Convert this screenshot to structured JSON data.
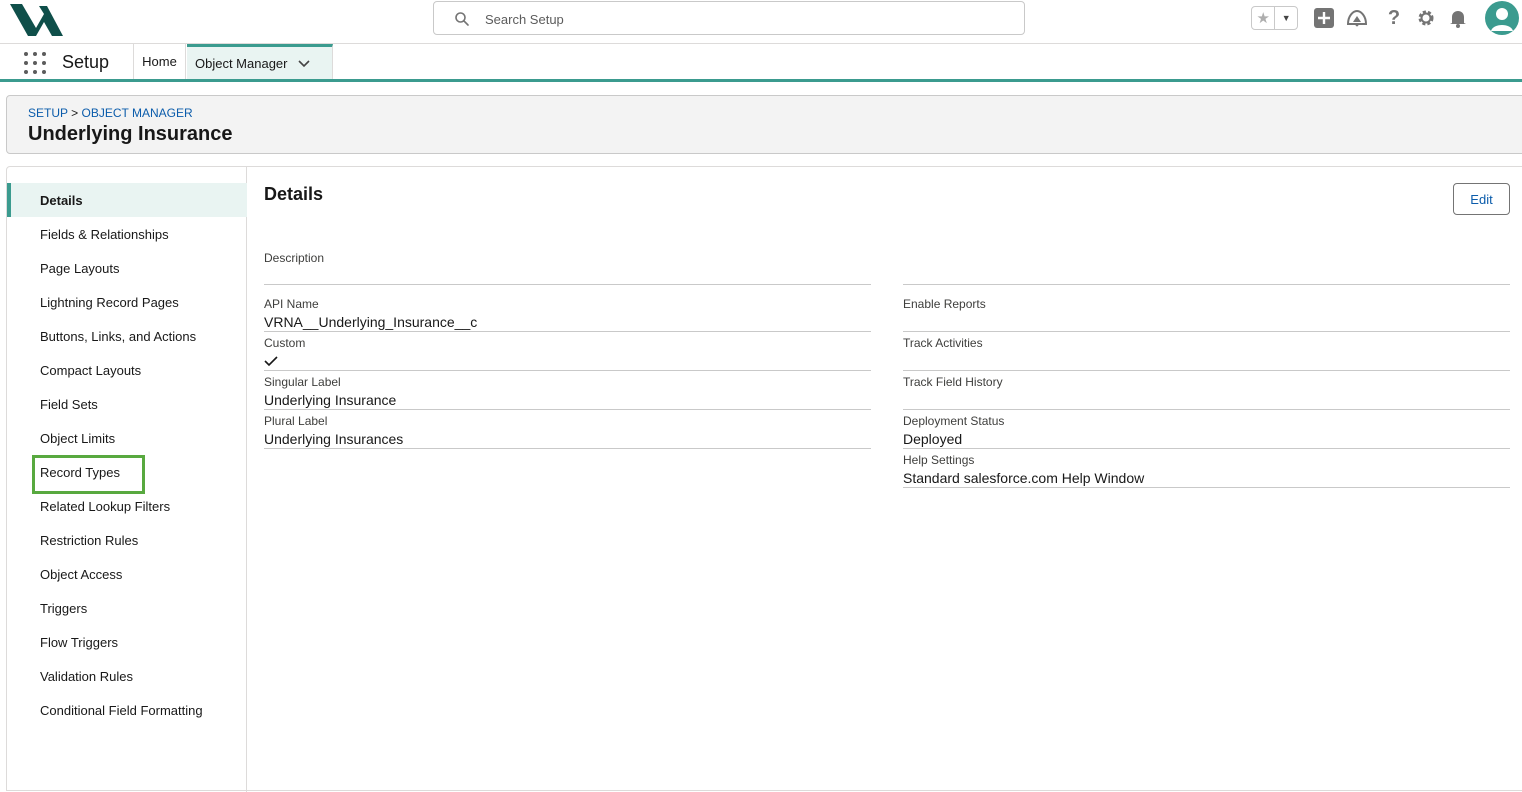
{
  "header": {
    "search_placeholder": "Search Setup",
    "icons": [
      "search-icon",
      "favorite-star-icon",
      "favorites-dropdown-icon",
      "global-actions-add-icon",
      "trailhead-icon",
      "help-icon",
      "setup-gear-icon",
      "notifications-bell-icon",
      "user-avatar-icon"
    ]
  },
  "nav": {
    "app_name": "Setup",
    "tabs": [
      {
        "label": "Home"
      },
      {
        "label": "Object Manager"
      }
    ]
  },
  "page": {
    "breadcrumb": {
      "setup": "SETUP",
      "sep": ">",
      "object_manager": "OBJECT MANAGER"
    },
    "title": "Underlying Insurance"
  },
  "sidebar": {
    "items": [
      {
        "label": "Details"
      },
      {
        "label": "Fields & Relationships"
      },
      {
        "label": "Page Layouts"
      },
      {
        "label": "Lightning Record Pages"
      },
      {
        "label": "Buttons, Links, and Actions"
      },
      {
        "label": "Compact Layouts"
      },
      {
        "label": "Field Sets"
      },
      {
        "label": "Object Limits"
      },
      {
        "label": "Record Types"
      },
      {
        "label": "Related Lookup Filters"
      },
      {
        "label": "Restriction Rules"
      },
      {
        "label": "Object Access"
      },
      {
        "label": "Triggers"
      },
      {
        "label": "Flow Triggers"
      },
      {
        "label": "Validation Rules"
      },
      {
        "label": "Conditional Field Formatting"
      }
    ],
    "active": "Details",
    "highlighted": "Record Types"
  },
  "details": {
    "title": "Details",
    "edit_label": "Edit",
    "left": [
      {
        "label": "Description",
        "value": ""
      },
      {
        "label": "API Name",
        "value": "VRNA__Underlying_Insurance__c"
      },
      {
        "label": "Custom",
        "value": ""
      },
      {
        "label": "Singular Label",
        "value": "Underlying Insurance"
      },
      {
        "label": "Plural Label",
        "value": "Underlying Insurances"
      }
    ],
    "right": [
      {
        "label": "",
        "value": ""
      },
      {
        "label": "Enable Reports",
        "value": ""
      },
      {
        "label": "Track Activities",
        "value": ""
      },
      {
        "label": "Track Field History",
        "value": ""
      },
      {
        "label": "Deployment Status",
        "value": "Deployed"
      },
      {
        "label": "Help Settings",
        "value": "Standard salesforce.com Help Window"
      }
    ],
    "custom_checked": true
  },
  "colors": {
    "accent": "#3b9b8f",
    "link": "#0b5cab",
    "highlight": "#58a93f"
  }
}
